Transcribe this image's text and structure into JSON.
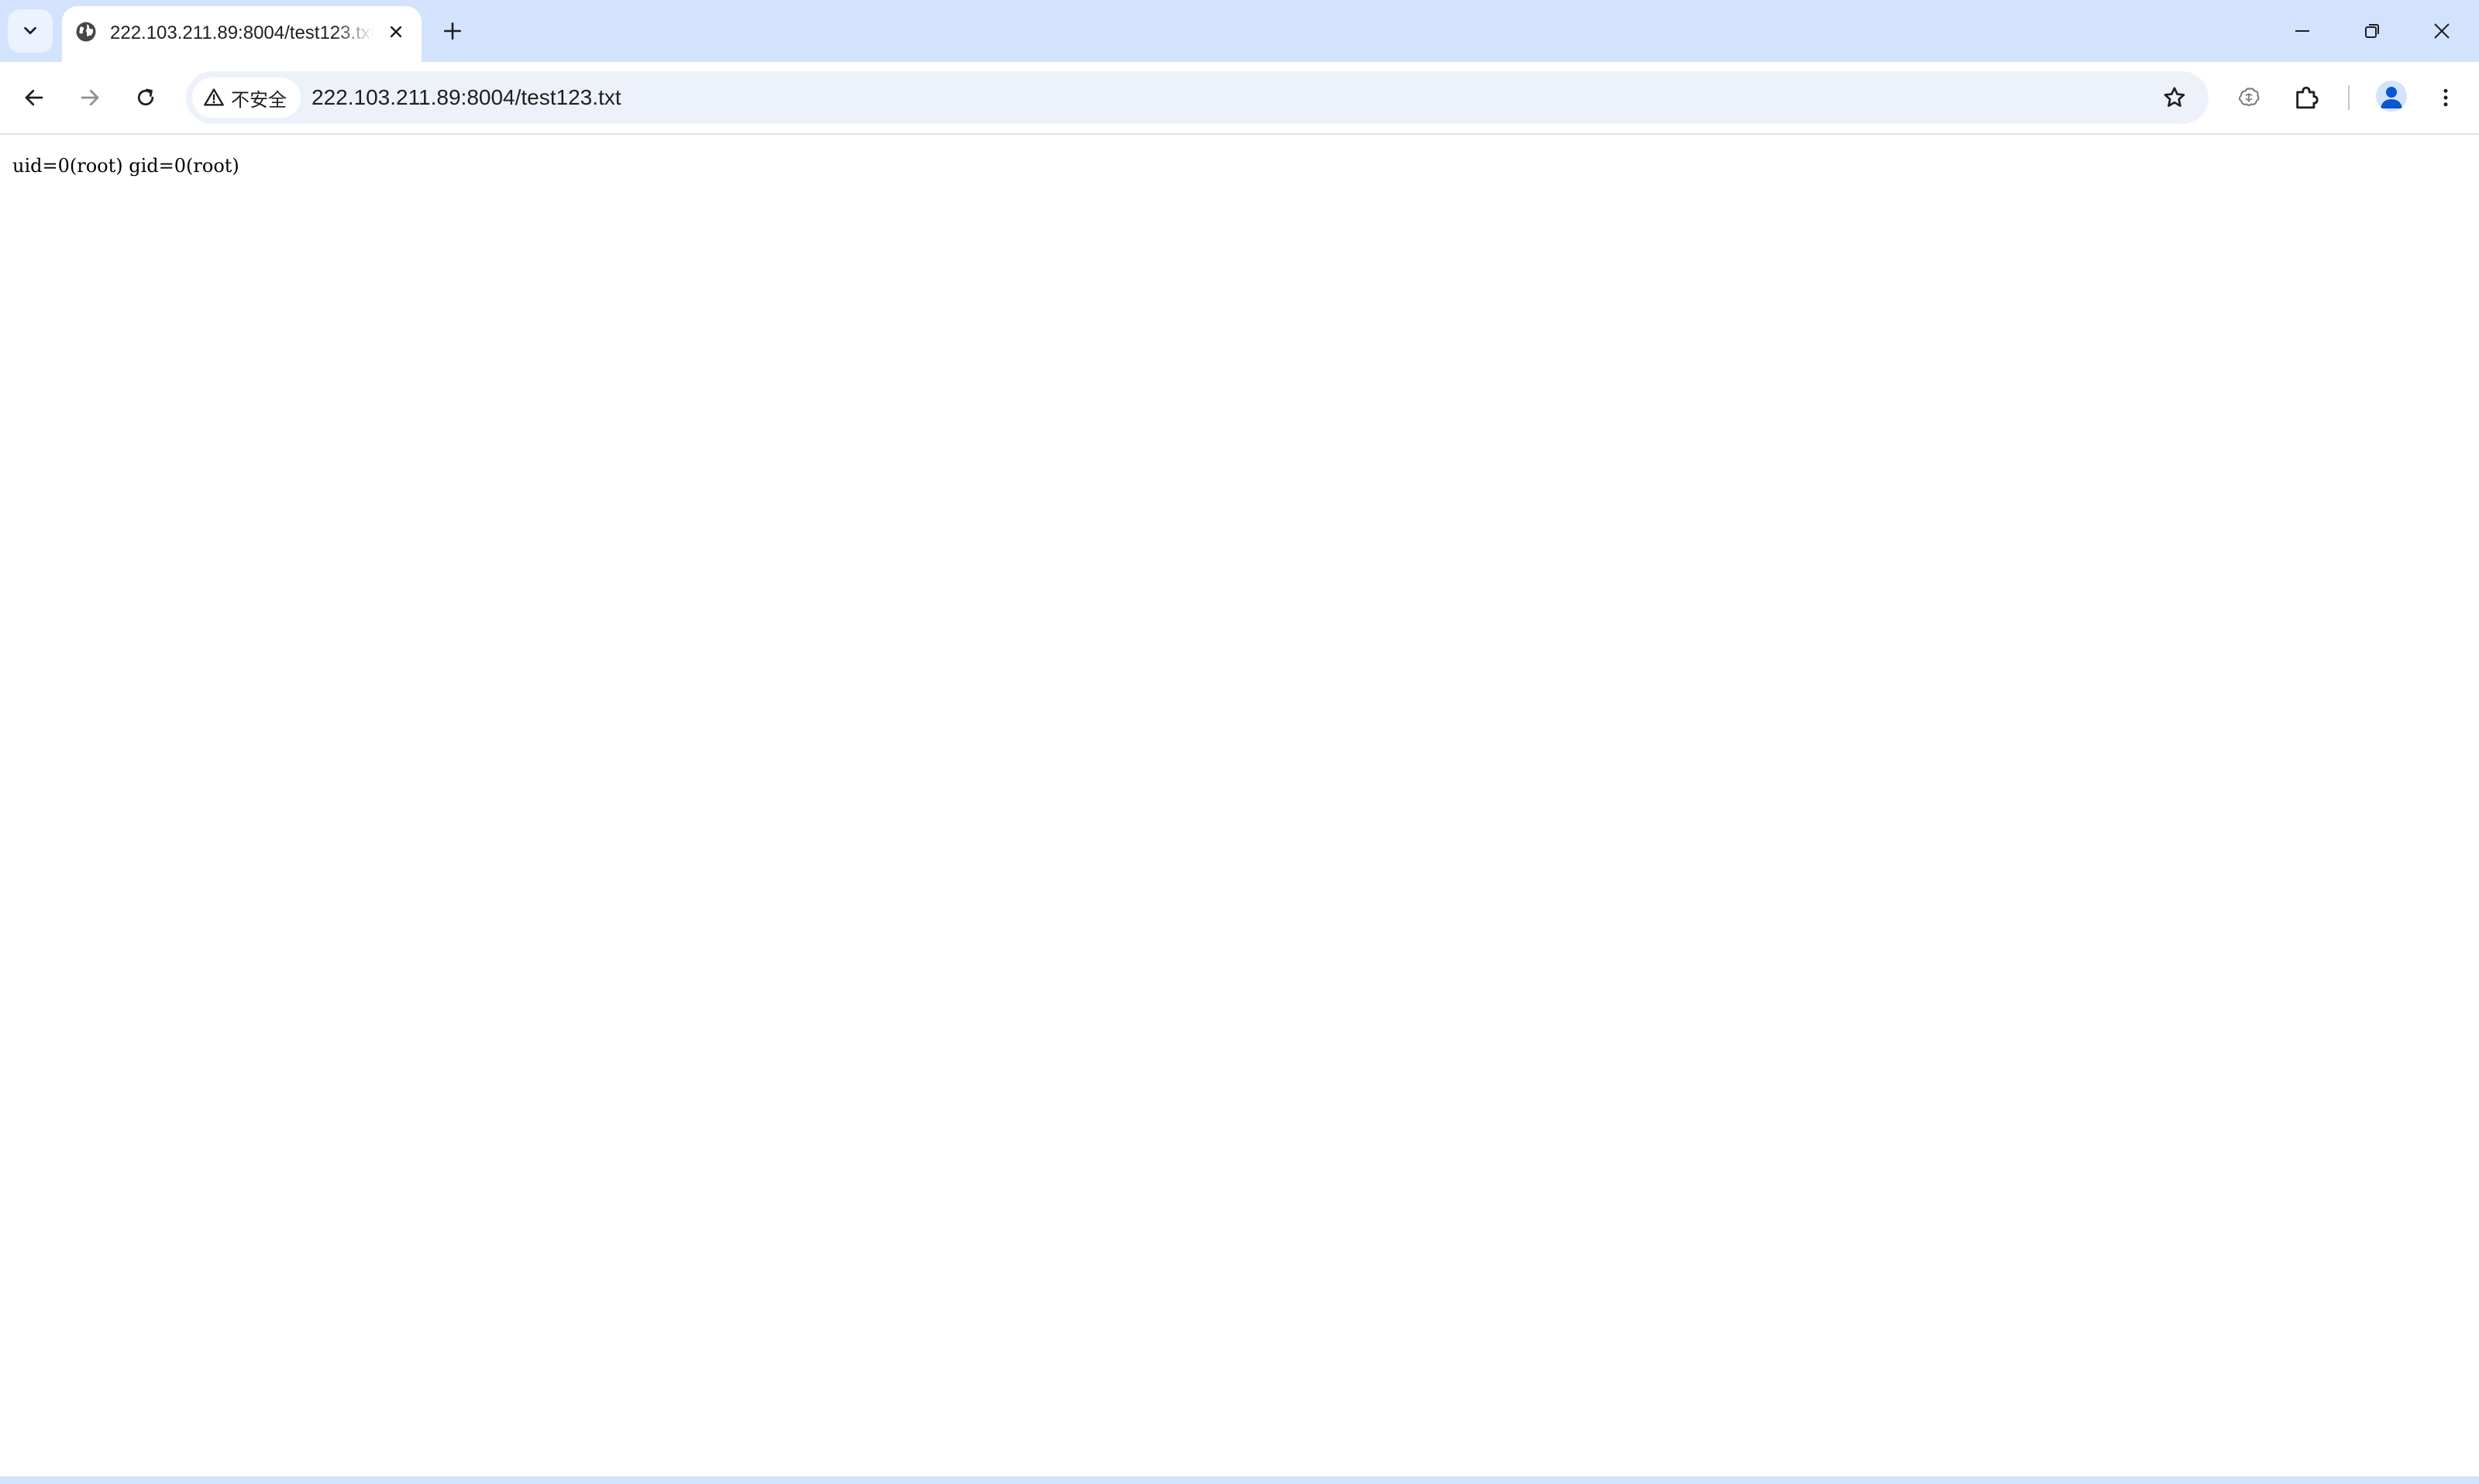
{
  "browser": {
    "tab": {
      "title": "222.103.211.89:8004/test123.txt",
      "favicon": "globe-icon"
    },
    "address_bar": {
      "security_label": "不安全",
      "url": "222.103.211.89:8004/test123.txt"
    },
    "icons": {
      "tab_search": "chevron-down-icon",
      "tab_close": "close-icon",
      "new_tab": "plus-icon",
      "minimize": "minimize-icon",
      "restore": "restore-icon",
      "close_window": "close-window-icon",
      "back": "back-arrow-icon",
      "forward": "forward-arrow-icon",
      "reload": "reload-icon",
      "warning": "warning-icon",
      "bookmark": "star-icon",
      "extension_1": "extension-icon",
      "extensions": "puzzle-icon",
      "profile": "profile-avatar-icon",
      "menu": "more-vertical-icon"
    },
    "colors": {
      "tabstrip_bg": "#d3e3fd",
      "omnibox_bg": "#edf2fa",
      "accent": "#0b57d0"
    }
  },
  "page": {
    "content": "uid=0(root) gid=0(root)"
  }
}
